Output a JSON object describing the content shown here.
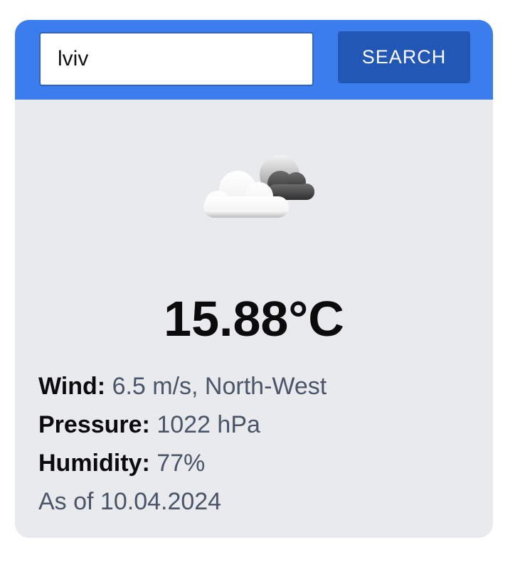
{
  "search": {
    "value": "lviv",
    "button_label": "SEARCH"
  },
  "weather": {
    "icon": "partly-cloudy-icon",
    "temperature": "15.88°C",
    "wind": {
      "label": "Wind:",
      "value": "6.5 m/s, North-West"
    },
    "pressure": {
      "label": "Pressure:",
      "value": "1022 hPa"
    },
    "humidity": {
      "label": "Humidity:",
      "value": "77%"
    },
    "as_of": "As of 10.04.2024"
  },
  "colors": {
    "header": "#3b7ded",
    "button": "#2357b6",
    "card": "#e8eaee",
    "muted_text": "#4a5568"
  }
}
